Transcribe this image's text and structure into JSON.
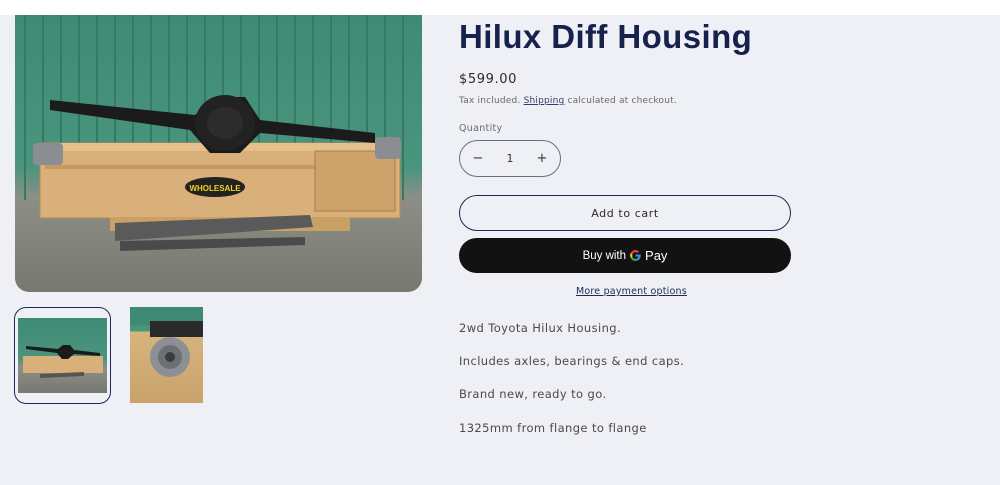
{
  "product": {
    "title": "Hilux Diff Housing",
    "price": "$599.00",
    "tax_prefix": "Tax included. ",
    "shipping_link": "Shipping",
    "tax_suffix": " calculated at checkout.",
    "quantity_label": "Quantity",
    "quantity_value": "1",
    "minus": "−",
    "plus": "+",
    "add_to_cart": "Add to cart",
    "buy_with": "Buy with",
    "gpay_g": "G",
    "gpay_pay": "Pay",
    "more_payment": "More payment options",
    "description": [
      "2wd Toyota Hilux Housing.",
      "Includes axles, bearings & end caps.",
      "Brand new, ready to go.",
      "1325mm from flange to flange"
    ]
  },
  "gallery": {
    "crate_text": "WHOLESALE"
  },
  "colors": {
    "title": "#16224d",
    "background": "#eff0f5",
    "button_dark": "#121212"
  }
}
